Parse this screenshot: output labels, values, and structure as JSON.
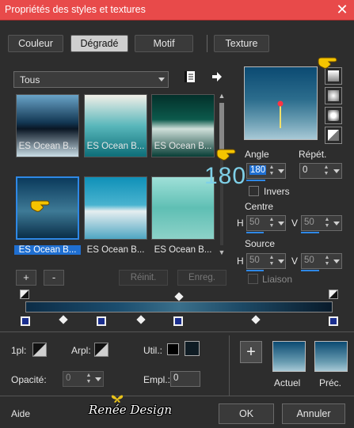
{
  "window": {
    "title": "Propriétés des styles et textures",
    "close": "✕"
  },
  "tabs": [
    {
      "label": "Couleur",
      "active": false
    },
    {
      "label": "Dégradé",
      "active": true
    },
    {
      "label": "Motif",
      "active": false
    },
    {
      "label": "Texture",
      "active": false
    }
  ],
  "library": {
    "dropdown_value": "Tous",
    "items": [
      {
        "label": "ES Ocean B...",
        "selected": false
      },
      {
        "label": "ES Ocean B...",
        "selected": false
      },
      {
        "label": "ES Ocean B...",
        "selected": false
      },
      {
        "label": "ES Ocean B...",
        "selected": true
      },
      {
        "label": "ES Ocean B...",
        "selected": false
      },
      {
        "label": "ES Ocean B...",
        "selected": false
      }
    ],
    "add_label": "+",
    "remove_label": "-",
    "reset_label": "Réinit.",
    "save_label": "Enreg."
  },
  "params": {
    "angle_label": "Angle",
    "angle_value": "180",
    "repeat_label": "Répét.",
    "repeat_value": "0",
    "invert_label": "Invers",
    "center_label": "Centre",
    "center_h_label": "H",
    "center_h_value": "50",
    "center_v_label": "V",
    "center_v_value": "50",
    "source_label": "Source",
    "source_h_label": "H",
    "source_h_value": "50",
    "source_v_label": "V",
    "source_v_value": "50",
    "link_label": "Liaison"
  },
  "annotation": {
    "angle_overlay": "180"
  },
  "bottom": {
    "first_label": "1pl:",
    "arpl_label": "Arpl:",
    "util_label": "Util.:",
    "opacity_label": "Opacité:",
    "opacity_value": "0",
    "empl_label": "Empl.:",
    "empl_value": "0",
    "current_label": "Actuel",
    "previous_label": "Préc.",
    "add_label": "+"
  },
  "footer": {
    "help_label": "Aide",
    "watermark": "Renée Design",
    "ok_label": "OK",
    "cancel_label": "Annuler"
  },
  "colors": {
    "titlebar": "#e84a4a",
    "accent": "#2e88e6",
    "selection": "#1f6fd1",
    "gradient_dark": "#0c2c46",
    "gradient_light": "#a8c9d6"
  },
  "icons": {
    "close": "close-icon",
    "library": "library-icon",
    "arrow": "arrow-right-icon",
    "hand": "pointing-hand-icon",
    "butterfly": "butterfly-icon"
  }
}
